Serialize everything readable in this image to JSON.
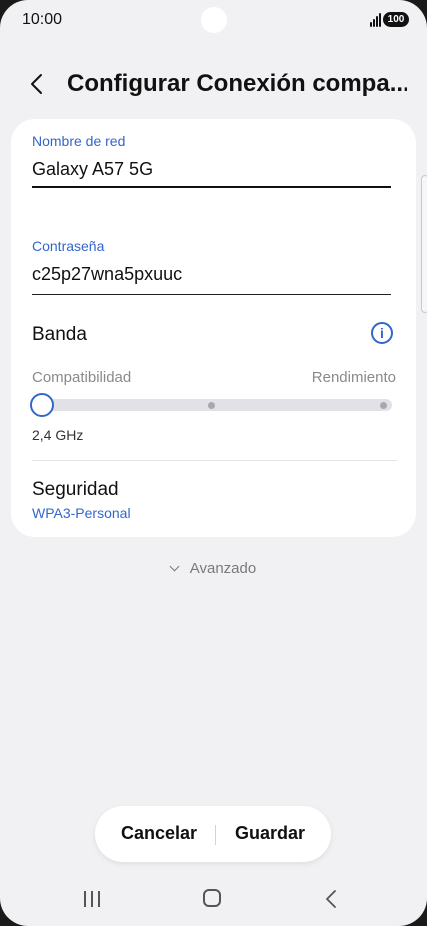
{
  "status_bar": {
    "time": "10:00",
    "battery": "100"
  },
  "header": {
    "title": "Configurar Conexión compa..."
  },
  "network_name": {
    "label": "Nombre de red",
    "value": "Galaxy A57 5G"
  },
  "password": {
    "label": "Contraseña",
    "value": "c25p27wna5pxuuc"
  },
  "band": {
    "title": "Banda",
    "left_label": "Compatibilidad",
    "right_label": "Rendimiento",
    "selected_value": "2,4 GHz",
    "slider_position": 0
  },
  "security": {
    "title": "Seguridad",
    "value": "WPA3-Personal"
  },
  "advanced": {
    "label": "Avanzado"
  },
  "actions": {
    "cancel_label": "Cancelar",
    "save_label": "Guardar"
  },
  "colors": {
    "accent": "#3366cc",
    "background": "#f1f1f4",
    "card": "#ffffff"
  },
  "icons": [
    "back-icon",
    "info-icon",
    "chevron-down-icon",
    "signal-icon",
    "battery-icon",
    "nav-recent-icon",
    "nav-home-icon",
    "nav-back-icon"
  ]
}
